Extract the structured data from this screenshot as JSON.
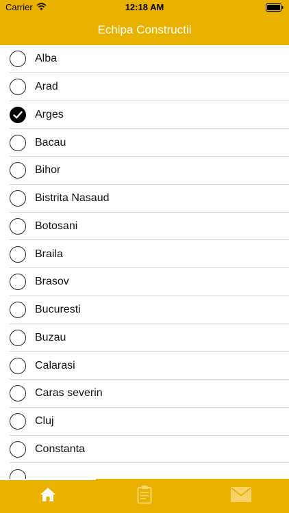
{
  "status_bar": {
    "carrier": "Carrier",
    "time": "12:18 AM",
    "icons": [
      "wifi-icon",
      "battery-icon"
    ]
  },
  "nav": {
    "title": "Echipa Constructii"
  },
  "colors": {
    "accent": "#e9b200",
    "tab_inactive": "#f7d36a",
    "tab_active": "#ffffff"
  },
  "list": {
    "items": [
      {
        "label": "Alba",
        "selected": false
      },
      {
        "label": "Arad",
        "selected": false
      },
      {
        "label": "Arges",
        "selected": true
      },
      {
        "label": "Bacau",
        "selected": false
      },
      {
        "label": "Bihor",
        "selected": false
      },
      {
        "label": "Bistrita Nasaud",
        "selected": false
      },
      {
        "label": "Botosani",
        "selected": false
      },
      {
        "label": "Braila",
        "selected": false
      },
      {
        "label": "Brasov",
        "selected": false
      },
      {
        "label": "Bucuresti",
        "selected": false
      },
      {
        "label": "Buzau",
        "selected": false
      },
      {
        "label": "Calarasi",
        "selected": false
      },
      {
        "label": "Caras severin",
        "selected": false
      },
      {
        "label": "Cluj",
        "selected": false
      },
      {
        "label": "Constanta",
        "selected": false
      },
      {
        "label": "",
        "selected": false
      }
    ]
  },
  "tab_bar": {
    "tabs": [
      {
        "icon": "home-icon",
        "active": true
      },
      {
        "icon": "clipboard-icon",
        "active": false
      },
      {
        "icon": "mail-icon",
        "active": false
      }
    ]
  }
}
